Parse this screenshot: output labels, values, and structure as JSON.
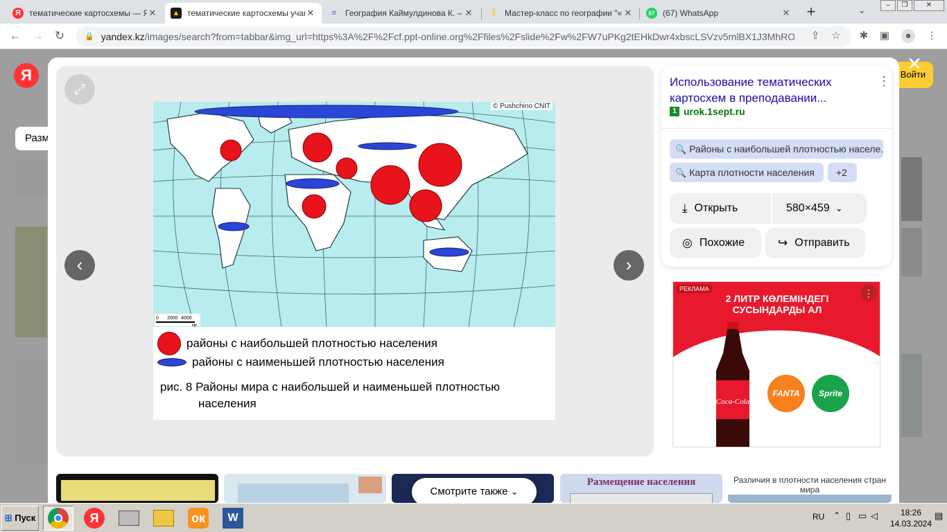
{
  "browser": {
    "tabs": [
      {
        "title": "тематические картосхемы — Ян",
        "icon": "yandex-icon"
      },
      {
        "title": "тематические картосхемы учащ",
        "icon": "image-icon"
      },
      {
        "title": "География Каймулдинова К. – С",
        "icon": "book-icon"
      },
      {
        "title": "Мастер-класс по географии \"«И",
        "icon": "infourok-icon"
      },
      {
        "title": "(67) WhatsApp",
        "icon": "whatsapp-icon",
        "badge": "67"
      }
    ],
    "new_tab": "+",
    "url_host": "yandex.kz",
    "url_rest": "/images/search?from=tabbar&img_url=https%3A%2F%2Fcf.ppt-online.org%2Ffiles%2Fslide%2Fw%2FW7uPKg2tEHkDwr4xbscLSVzv5mlBX1J3MhROjZ..."
  },
  "page": {
    "logo": "Я",
    "size_filter": "Размер",
    "login_label": "Войти"
  },
  "viewer": {
    "close": "✕",
    "map_credit": "© Pushchino CNIT",
    "scale_labels": [
      "0",
      "2000",
      "4000",
      "км"
    ],
    "legend": [
      {
        "label": "районы с наибольшей плотностью населения",
        "color": "#e8131b"
      },
      {
        "label": "районы с наименьшей плотностью населения",
        "color": "#2b46d4"
      }
    ],
    "caption_line1": "рис. 8 Районы мира с наибольшей и наименьшей плотностью",
    "caption_line2": "населения"
  },
  "side_panel": {
    "title": "Использование тематических картосхем в преподавании...",
    "site": "urok.1sept.ru",
    "tags": [
      "Районы с наибольшей плотностью населе...",
      "Карта плотности населения"
    ],
    "more_tags": "+2",
    "open_label": "Открыть",
    "size_label": "580×459",
    "similar_label": "Похожие",
    "share_label": "Отправить"
  },
  "ad": {
    "tag": "РЕКЛАМА",
    "headline_1": "2 ЛИТР КӨЛЕМІНДЕГІ",
    "headline_2": "СУСЫНДАРДЫ АЛ",
    "brand_cola": "Coca-Cola",
    "brand_fanta": "FANTA",
    "brand_sprite": "Sprite"
  },
  "related": {
    "see_also": "Смотрите также",
    "thumb_4_title": "Размещение населения",
    "thumb_5_title": "Различия в плотности населения стран мира"
  },
  "taskbar": {
    "start": "Пуск",
    "lang": "RU",
    "time": "18:26",
    "date": "14.03.2024"
  }
}
